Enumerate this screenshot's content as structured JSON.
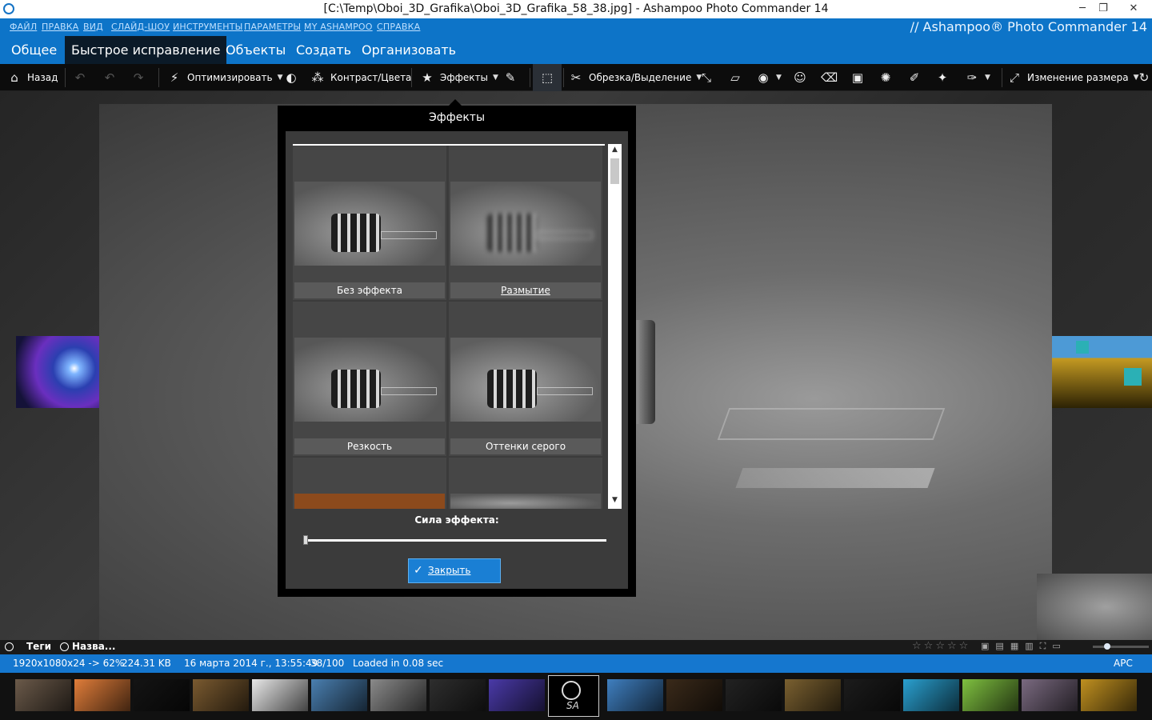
{
  "window": {
    "title": "[C:\\Temp\\Oboi_3D_Grafika\\Oboi_3D_Grafika_58_38.jpg] - Ashampoo Photo Commander 14",
    "minimize": "─",
    "restore": "❐",
    "close": "✕"
  },
  "menu": [
    "ФАЙЛ",
    "ПРАВКА",
    "ВИД",
    "СЛАЙД-ШОУ",
    "ИНСТРУМЕНТЫ",
    "ПАРАМЕТРЫ",
    "MY ASHAMPOO",
    "СПРАВКА"
  ],
  "brand": "// Ashampoo® Photo Commander 14",
  "tabs": [
    "Общее",
    "Быстрое исправление",
    "Объекты",
    "Создать",
    "Организовать"
  ],
  "toolbar": {
    "back": "Назад",
    "optimize": "Оптимизировать",
    "contrast": "Контраст/Цвета",
    "effects": "Эффекты",
    "crop": "Обрезка/Выделение",
    "resize": "Изменение размера"
  },
  "dialog": {
    "title": "Эффекты",
    "effects": [
      "Без эффекта",
      "Размытие",
      "Резкость",
      "Оттенки серого"
    ],
    "strength_label": "Сила эффекта:",
    "strength_value": 0,
    "close": "Закрыть"
  },
  "info": {
    "tags": "Теги",
    "name": "Назва..."
  },
  "status": {
    "dimensions": "1920x1080x24 -> 62%",
    "filesize": "224.31 KB",
    "date": "16 марта 2014 г., 13:55:49",
    "position": "38/100",
    "loaded": "Loaded in 0.08 sec",
    "lang": "APC"
  },
  "filmstrip": {
    "selected_index": 9,
    "selected_caption": "SA",
    "colors": [
      "#6b5a4a",
      "#e07d3a",
      "#141414",
      "#7a5a30",
      "#e8e8e8",
      "#4a7fb0",
      "#8a8a8a",
      "#2e2e2e",
      "#4a3aa8",
      "#000000",
      "#3f7fc0",
      "#3a2a1a",
      "#222222",
      "#7a6030",
      "#1c1c1c",
      "#2aa0d0",
      "#7fc040",
      "#7a6a80",
      "#c09020"
    ]
  }
}
